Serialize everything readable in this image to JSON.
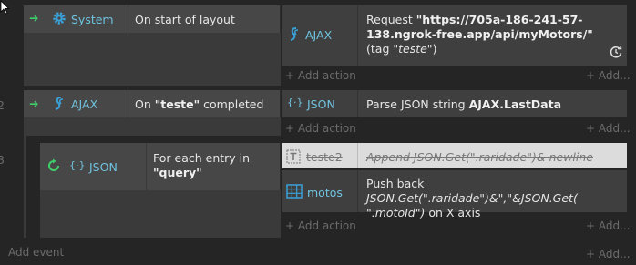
{
  "events": [
    {
      "object": "System",
      "condition": "On start of layout",
      "actions": [
        {
          "object": "AJAX",
          "pre": "Request ",
          "bold": "\"https://705a-186-241-57-138.ngrok-free.app/api/myMotors/\"",
          "mid": " (tag ",
          "italic": "\"teste\"",
          "post": ")"
        }
      ],
      "add_action": "Add action",
      "add_right": "Add..."
    },
    {
      "number": "2",
      "object": "AJAX",
      "condition_pre": "On ",
      "condition_bold": "\"teste\"",
      "condition_post": " completed",
      "actions": [
        {
          "object": "JSON",
          "pre": "Parse JSON string ",
          "bold": "AJAX.LastData"
        }
      ],
      "add_action": "Add action",
      "add_right": "Add..."
    },
    {
      "number": "3",
      "object": "JSON",
      "condition_line1": "For each entry in",
      "condition_bold": "\"query\"",
      "actions": [
        {
          "object": "teste2",
          "text": "Append JSON.Get(\".raridade\")& newline",
          "disabled": true
        },
        {
          "object": "motos",
          "pre": "Push back ",
          "italic1": "JSON.Get(\".raridade\")&\",\"&JSON.Get(",
          "italic2": "\".motoId\")",
          "post": " on X axis"
        }
      ],
      "add_action": "Add action",
      "add_right": "Add..."
    }
  ],
  "add_event": "Add event",
  "add_event_right": "Add...",
  "colors": {
    "background": "#252525",
    "row": "#3a3a3a",
    "condition_cell": "#474747",
    "highlight_row": "#dcdcdc",
    "trigger_text": "#6fc3df",
    "arrow_green": "#3fcf6a"
  },
  "icons": [
    "cursor-icon",
    "gear-icon",
    "ajax-icon",
    "json-icon",
    "loop-icon",
    "text-icon",
    "array-icon",
    "restart-icon",
    "plus-icon"
  ]
}
